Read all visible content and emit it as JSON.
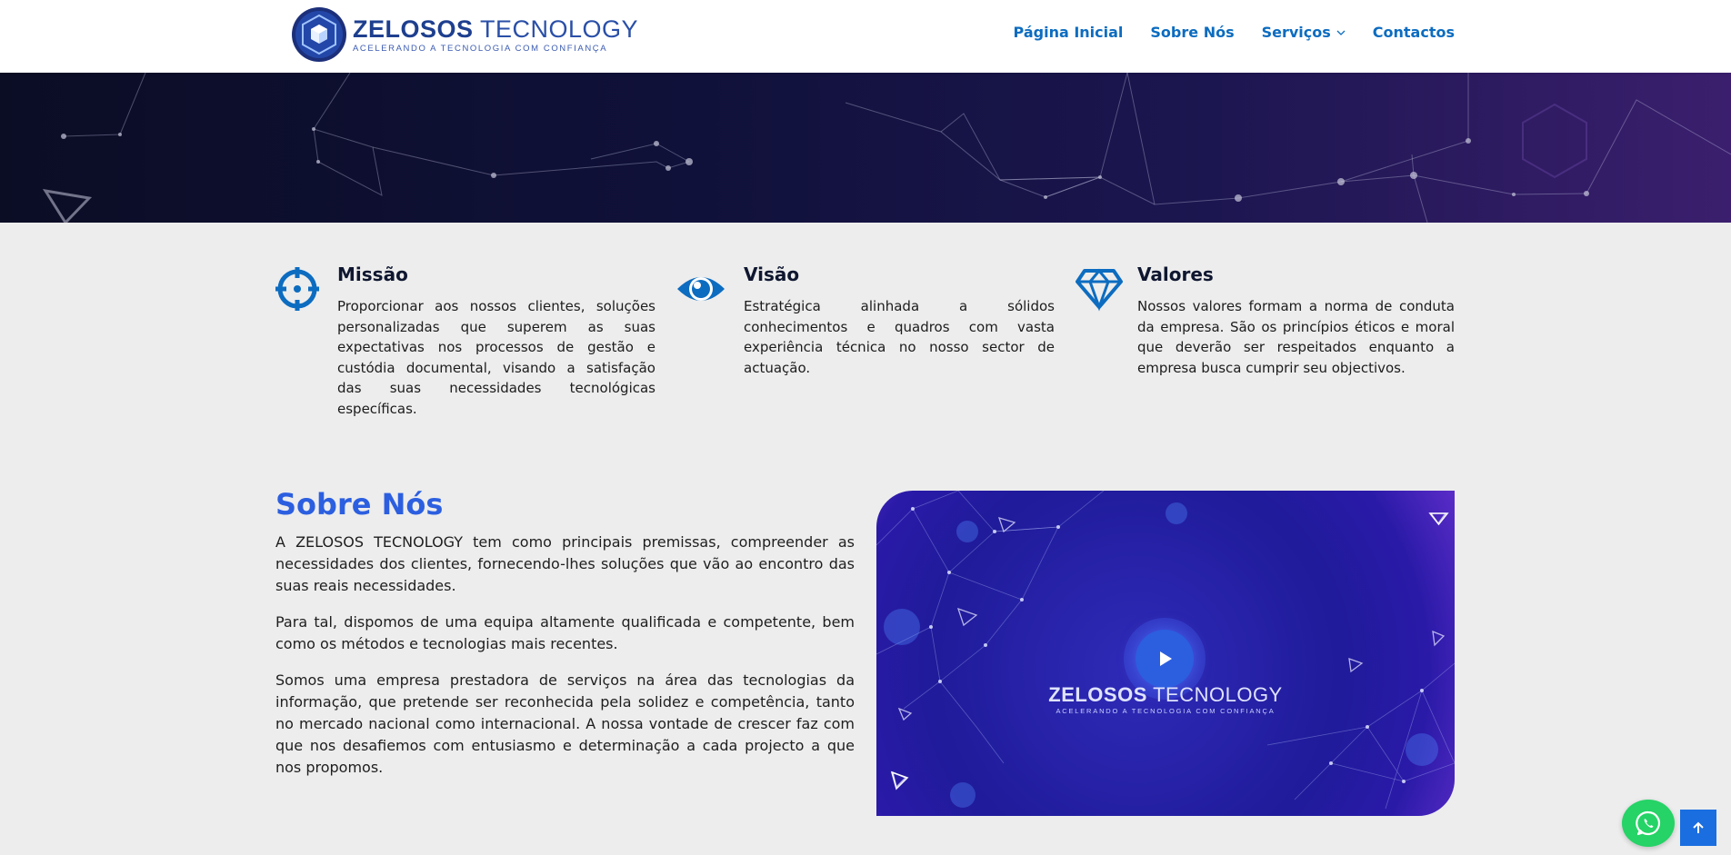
{
  "brand": {
    "name_bold": "ZELOSOS",
    "name_light": "TECNOLOGY",
    "tagline": "ACELERANDO A TECNOLOGIA COM CONFIANÇA"
  },
  "nav": {
    "items": [
      {
        "label": "Página Inicial"
      },
      {
        "label": "Sobre Nós"
      },
      {
        "label": "Serviços"
      },
      {
        "label": "Contactos"
      }
    ]
  },
  "features": [
    {
      "title": "Missão",
      "text": "Proporcionar aos nossos clientes, soluções personalizadas que superem as suas expectativas nos processos de gestão e custódia documental, visando a satisfação das suas necessidades tecnológicas específicas.",
      "icon": "crosshair-icon"
    },
    {
      "title": "Visão",
      "text": "Estratégica alinhada a sólidos conhecimentos e quadros com vasta experiência técnica no nosso sector de actuação.",
      "icon": "eye-icon"
    },
    {
      "title": "Valores",
      "text": "Nossos valores formam a norma de conduta da empresa. São os princípios éticos e moral que deverão ser respeitados enquanto a empresa busca cumprir seu objectivos.",
      "icon": "diamond-icon"
    }
  ],
  "about": {
    "title": "Sobre Nós",
    "paragraphs": [
      "A ZELOSOS TECNOLOGY tem como principais premissas, compreender as necessidades dos clientes, fornecendo-lhes soluções que vão ao encontro das suas reais necessidades.",
      "Para tal, dispomos de uma equipa altamente qualificada e competente, bem como os métodos e tecnologias mais recentes.",
      "Somos uma empresa prestadora de serviços na área das tecnologias da informação, que pretende ser reconhecida pela solidez e competência, tanto no mercado nacional como internacional. A nossa vontade de crescer faz com que nos desafiemos com entusiasmo e determinação a cada projecto a que nos propomos."
    ]
  },
  "video": {
    "brand_bold": "ZELOSOS",
    "brand_light": "TECNOLOGY",
    "tagline": "ACELERANDO A TECNOLOGIA COM CONFIANÇA"
  },
  "colors": {
    "accent": "#0c6cc0",
    "heading_blue": "#2c5fe0",
    "whatsapp": "#25d366",
    "scroll_top": "#1a6ee0"
  }
}
